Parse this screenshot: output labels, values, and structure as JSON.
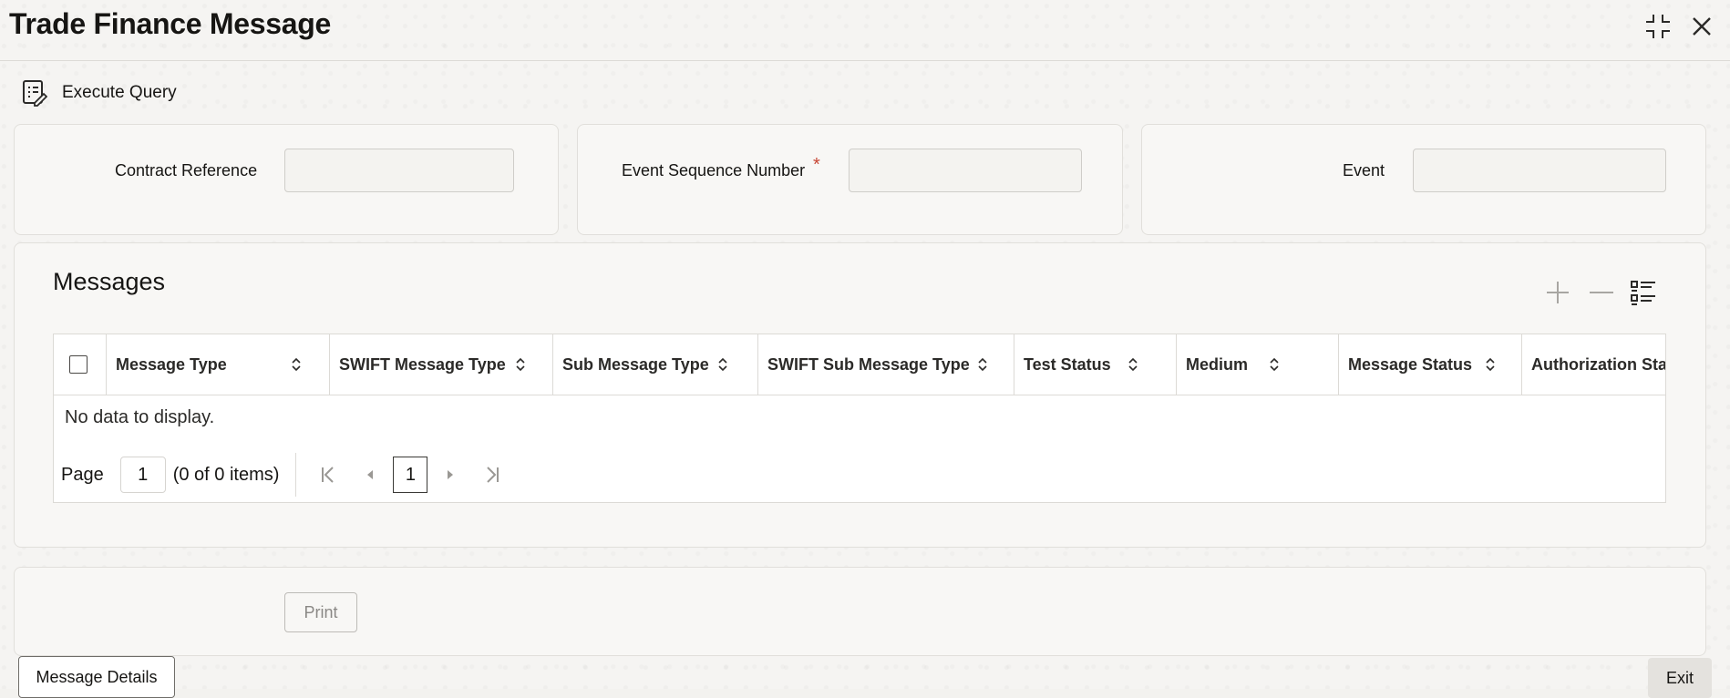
{
  "window": {
    "title": "Trade Finance Message",
    "icons": [
      "collapse-icon",
      "close-icon"
    ]
  },
  "toolbar": {
    "execute_query_label": "Execute Query",
    "icon": "query-doc-icon"
  },
  "fields": {
    "contract_reference": {
      "label": "Contract Reference",
      "value": ""
    },
    "event_sequence_number": {
      "label": "Event Sequence Number",
      "required_mark": "*",
      "value": ""
    },
    "event": {
      "label": "Event",
      "value": ""
    }
  },
  "messages": {
    "title": "Messages",
    "columns": [
      "Message Type",
      "SWIFT Message Type",
      "Sub Message Type",
      "SWIFT Sub Message Type",
      "Test Status",
      "Medium",
      "Message Status",
      "Authorization Status"
    ],
    "empty_text": "No data to display.",
    "pagination": {
      "page_label": "Page",
      "page_value": "1",
      "items_text": "(0 of 0 items)",
      "current_page": "1"
    }
  },
  "buttons": {
    "print": "Print",
    "message_details": "Message Details",
    "exit": "Exit"
  },
  "colors": {
    "required": "#c74634",
    "text": "#161513",
    "disabled_text": "#8a8885"
  }
}
